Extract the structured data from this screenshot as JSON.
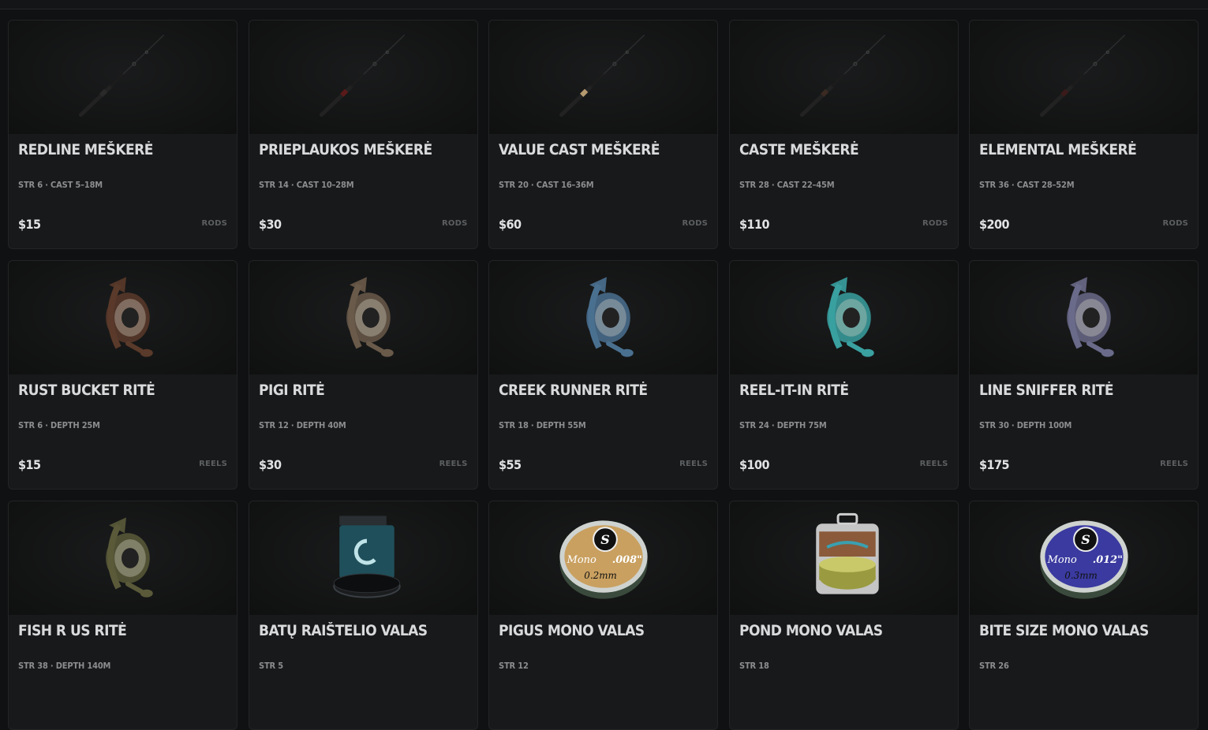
{
  "products": [
    {
      "name": "REDLINE MEŠKERĖ",
      "stats": "STR 6 · CAST 5–18M",
      "price": "$15",
      "category": "RODS",
      "icon": "fishing-rod-icon",
      "accent": "#2a2a2a"
    },
    {
      "name": "PRIEPLAUKOS MEŠKERĖ",
      "stats": "STR 14 · CAST 10–28M",
      "price": "$30",
      "category": "RODS",
      "icon": "fishing-rod-icon",
      "accent": "#5a1a1a"
    },
    {
      "name": "VALUE CAST MEŠKERĖ",
      "stats": "STR 20 · CAST 16–36M",
      "price": "$60",
      "category": "RODS",
      "icon": "fishing-rod-icon",
      "accent": "#b59a70"
    },
    {
      "name": "CASTE MEŠKERĖ",
      "stats": "STR 28 · CAST 22–45M",
      "price": "$110",
      "category": "RODS",
      "icon": "fishing-rod-icon",
      "accent": "#3a2a22"
    },
    {
      "name": "ELEMENTAL MEŠKERĖ",
      "stats": "STR 36 · CAST 28–52M",
      "price": "$200",
      "category": "RODS",
      "icon": "fishing-rod-icon",
      "accent": "#3a1a1a"
    },
    {
      "name": "RUST BUCKET RITĖ",
      "stats": "STR 6 · DEPTH 25M",
      "price": "$15",
      "category": "REELS",
      "icon": "spinning-reel-icon",
      "accent": "#5a3a2a"
    },
    {
      "name": "PIGI RITĖ",
      "stats": "STR 12 · DEPTH 40M",
      "price": "$30",
      "category": "REELS",
      "icon": "spinning-reel-icon",
      "accent": "#6a5a4a"
    },
    {
      "name": "CREEK RUNNER RITĖ",
      "stats": "STR 18 · DEPTH 55M",
      "price": "$55",
      "category": "REELS",
      "icon": "spinning-reel-icon",
      "accent": "#4a7090"
    },
    {
      "name": "REEL-IT-IN RITĖ",
      "stats": "STR 24 · DEPTH 75M",
      "price": "$100",
      "category": "REELS",
      "icon": "spinning-reel-icon",
      "accent": "#3aa0a0"
    },
    {
      "name": "LINE SNIFFER RITĖ",
      "stats": "STR 30 · DEPTH 100M",
      "price": "$175",
      "category": "REELS",
      "icon": "spinning-reel-icon",
      "accent": "#6a6a8a"
    },
    {
      "name": "FISH R US RITĖ",
      "stats": "STR 38 · DEPTH 140M",
      "price": "",
      "category": "",
      "icon": "spinning-reel-icon",
      "accent": "#5a5a3a"
    },
    {
      "name": "BATŲ RAIŠTELIO VALAS",
      "stats": "STR 5",
      "price": "",
      "category": "",
      "icon": "line-box-icon",
      "accent": "#1f4f5a"
    },
    {
      "name": "PIGUS MONO VALAS",
      "stats": "STR 12",
      "price": "",
      "category": "",
      "icon": "line-spool-icon",
      "accent": "#c9a060",
      "label_top": "Mono",
      "label_side": ".008\"",
      "label_mm": "0.2mm"
    },
    {
      "name": "POND MONO VALAS",
      "stats": "STR 18",
      "price": "",
      "category": "",
      "icon": "line-spool-box-icon",
      "accent": "#9a9a40"
    },
    {
      "name": "BITE SIZE MONO VALAS",
      "stats": "STR 26",
      "price": "",
      "category": "",
      "icon": "line-spool-icon",
      "accent": "#3a3aa0",
      "label_top": "Mono",
      "label_side": ".012\"",
      "label_mm": "0.3mm"
    }
  ]
}
